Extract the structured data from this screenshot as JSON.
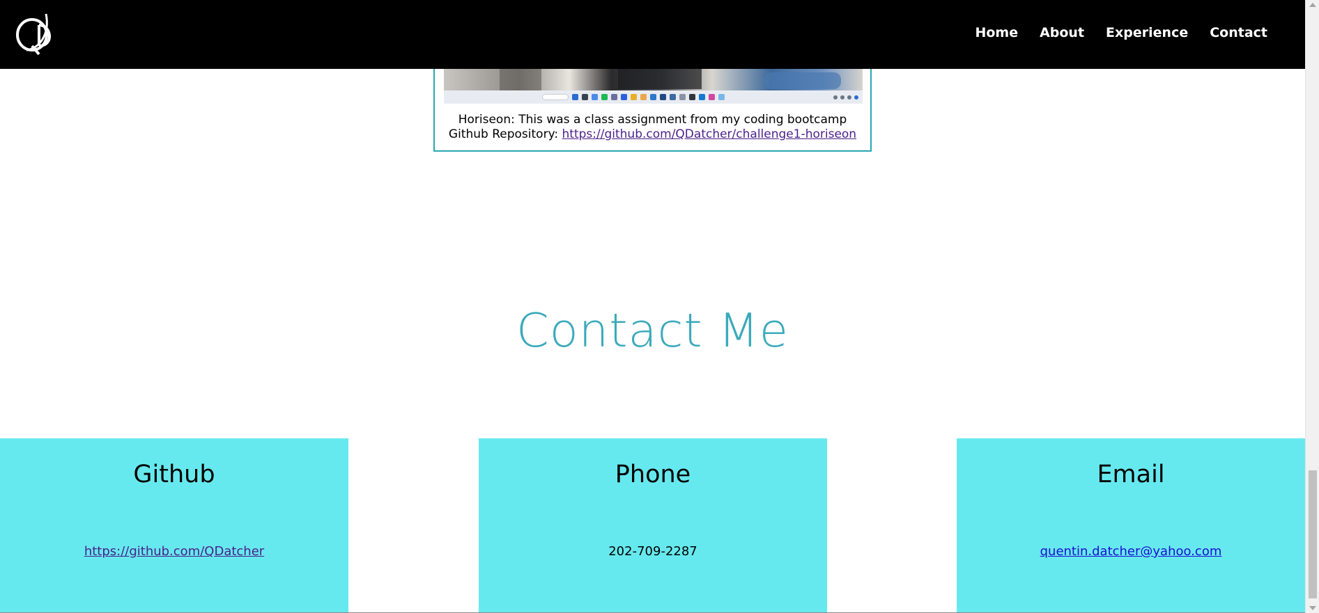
{
  "nav": {
    "logo_text": "QD",
    "links": [
      "Home",
      "About",
      "Experience",
      "Contact"
    ]
  },
  "project": {
    "description": "Horiseon: This was a class assignment from my coding bootcamp",
    "repo_label": "Github Repository: ",
    "repo_url": "https://github.com/QDatcher/challenge1-horiseon"
  },
  "contact": {
    "heading": "Contact Me",
    "cards": [
      {
        "title": "Github",
        "value": "https://github.com/QDatcher"
      },
      {
        "title": "Phone",
        "value": "202-709-2287"
      },
      {
        "title": "Email",
        "value": "quentin.datcher@yahoo.com"
      }
    ]
  },
  "colors": {
    "nav_bg": "#000000",
    "accent": "#3aaabb",
    "card_bg": "#66e9ee",
    "visited_link": "#4a1f8a",
    "link": "#1a0dd6"
  }
}
